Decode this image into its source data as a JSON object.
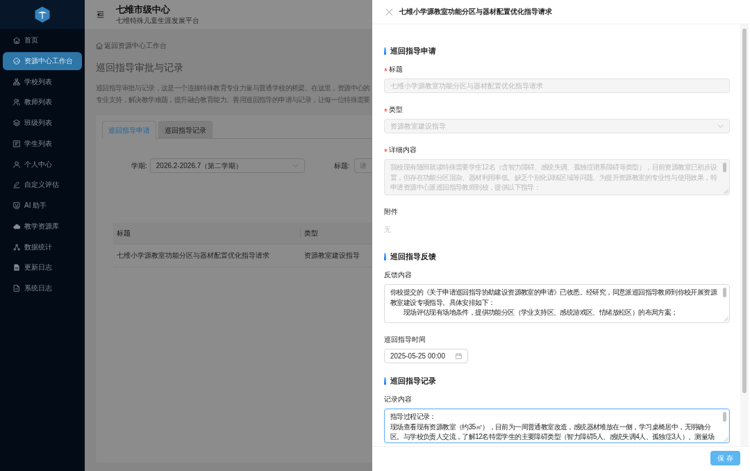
{
  "sidebar": {
    "items": [
      {
        "label": "首页",
        "selected": false
      },
      {
        "label": "资源中心工作台",
        "selected": true
      },
      {
        "label": "学校列表",
        "selected": false
      },
      {
        "label": "教师列表",
        "selected": false
      },
      {
        "label": "班级列表",
        "selected": false
      },
      {
        "label": "学生列表",
        "selected": false
      },
      {
        "label": "个人中心",
        "selected": false
      },
      {
        "label": "自定义评估",
        "selected": false
      },
      {
        "label": "AI 助手",
        "selected": false
      },
      {
        "label": "教学资源库",
        "selected": false
      },
      {
        "label": "数据统计",
        "selected": false
      },
      {
        "label": "更新日志",
        "selected": false
      },
      {
        "label": "系统日志",
        "selected": false
      }
    ]
  },
  "header": {
    "title": "七维市级中心",
    "subtitle": "七维特殊儿童生涯发展平台"
  },
  "page": {
    "breadcrumb": "返回资源中心工作台",
    "title": "巡回指导审批与记录",
    "description_lines": [
      "巡回指导审批与记录，这是一个连接特殊教育专业力量与普通学校的桥梁。在这里，资源中心的",
      "专业支持，解决教学难题，提升融合教育能力。善用巡回指导的申请与记录，让每一位特殊需要"
    ],
    "tabs": [
      {
        "label": "巡回指导申请",
        "selected": true
      },
      {
        "label": "巡回指导记录",
        "selected": false
      }
    ],
    "filters": [
      {
        "kind": "select",
        "label": "学期:",
        "value": "2026.2-2026.7（第二学期）"
      },
      {
        "kind": "input",
        "label": "标题:",
        "placeholder": "请"
      }
    ],
    "table": {
      "columns": [
        "标题",
        "类型"
      ],
      "rows": [
        [
          "七维小学源教室功能分区与器材配置优化指导请求",
          "资源教室建设指导"
        ]
      ]
    }
  },
  "drawer": {
    "title": "七维小学源教室功能分区与器材配置优化指导请求",
    "sections": [
      {
        "title": "巡回指导申请",
        "fields": [
          {
            "kind": "input",
            "label": "标题",
            "required": true,
            "disabled": true,
            "focused": false,
            "value": "七维小学源教室功能分区与器材配置优化指导请求"
          },
          {
            "kind": "select",
            "label": "类型",
            "required": true,
            "disabled": true,
            "focused": false,
            "value": "资源教室建设指导"
          },
          {
            "kind": "textarea",
            "label": "详细内容",
            "required": true,
            "disabled": true,
            "focused": false,
            "paragraphs": [
              {
                "text": "我校现有随班就读特殊需要学生12名（含智力障碍、感统失调、孤独症谱系障碍等类型），目前资源教室已初步设置，但存在功能分区混杂、器材利用率低、缺乏个别化训练区域等问题。为提升资源教室的专业性与使用效果，特申请资源中心派巡回指导教师到校，提供以下指导：",
                "indented": false
              }
            ]
          },
          {
            "kind": "text",
            "label": "附件",
            "required": false,
            "disabled": true,
            "focused": false,
            "value": "无"
          }
        ]
      },
      {
        "title": "巡回指导反馈",
        "fields": [
          {
            "kind": "textarea",
            "label": "反馈内容",
            "required": false,
            "disabled": false,
            "focused": false,
            "paragraphs": [
              {
                "text": "你校提交的《关于申请巡回指导协助建设资源教室的申请》已收悉。经研究，同意派巡回指导教师到你校开展资源教室建设专项指导。具体安排如下：",
                "indented": false
              },
              {
                "text": "现场评估现有场地条件，提供功能分区（学业支持区、感统游戏区、情绪放松区）的布局方案；",
                "indented": true
              }
            ]
          },
          {
            "kind": "date",
            "label": "巡回指导时间",
            "required": false,
            "disabled": false,
            "focused": false,
            "value": "2025-05-25 00:00"
          }
        ]
      },
      {
        "title": "巡回指导记录",
        "fields": [
          {
            "kind": "textarea",
            "label": "记录内容",
            "required": false,
            "disabled": false,
            "focused": true,
            "paragraphs": [
              {
                "text": "指导过程记录：",
                "indented": false
              },
              {
                "text": "现场查看现有资源教室（约35㎡），目前为一间普通教室改造，感统器材堆放在一侧，学习桌椅居中，无明确分区。与学校负责人交流，了解12名特需学生的主要障碍类型（智力障碍5人、感统失调4人、孤独症3人）。测量场",
                "indented": false
              }
            ]
          }
        ]
      }
    ],
    "save_button": "保 存"
  }
}
